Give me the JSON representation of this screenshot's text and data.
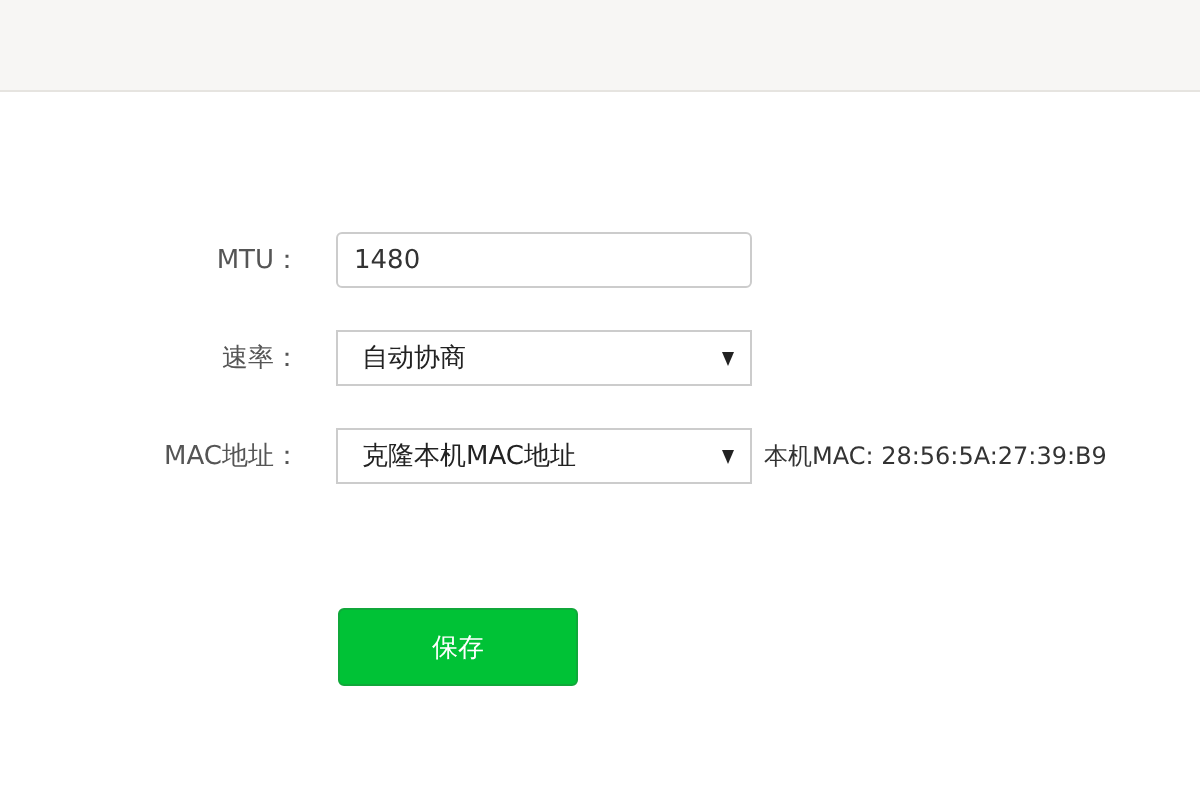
{
  "fields": [
    {
      "kind": "text",
      "label": "MTU：",
      "value": "1480"
    },
    {
      "kind": "select",
      "label": "速率：",
      "value": "自动协商"
    },
    {
      "kind": "select",
      "label": "MAC地址：",
      "value": "克隆本机MAC地址",
      "note": "本机MAC: 28:56:5A:27:39:B9"
    }
  ],
  "buttons": [
    "保存"
  ]
}
